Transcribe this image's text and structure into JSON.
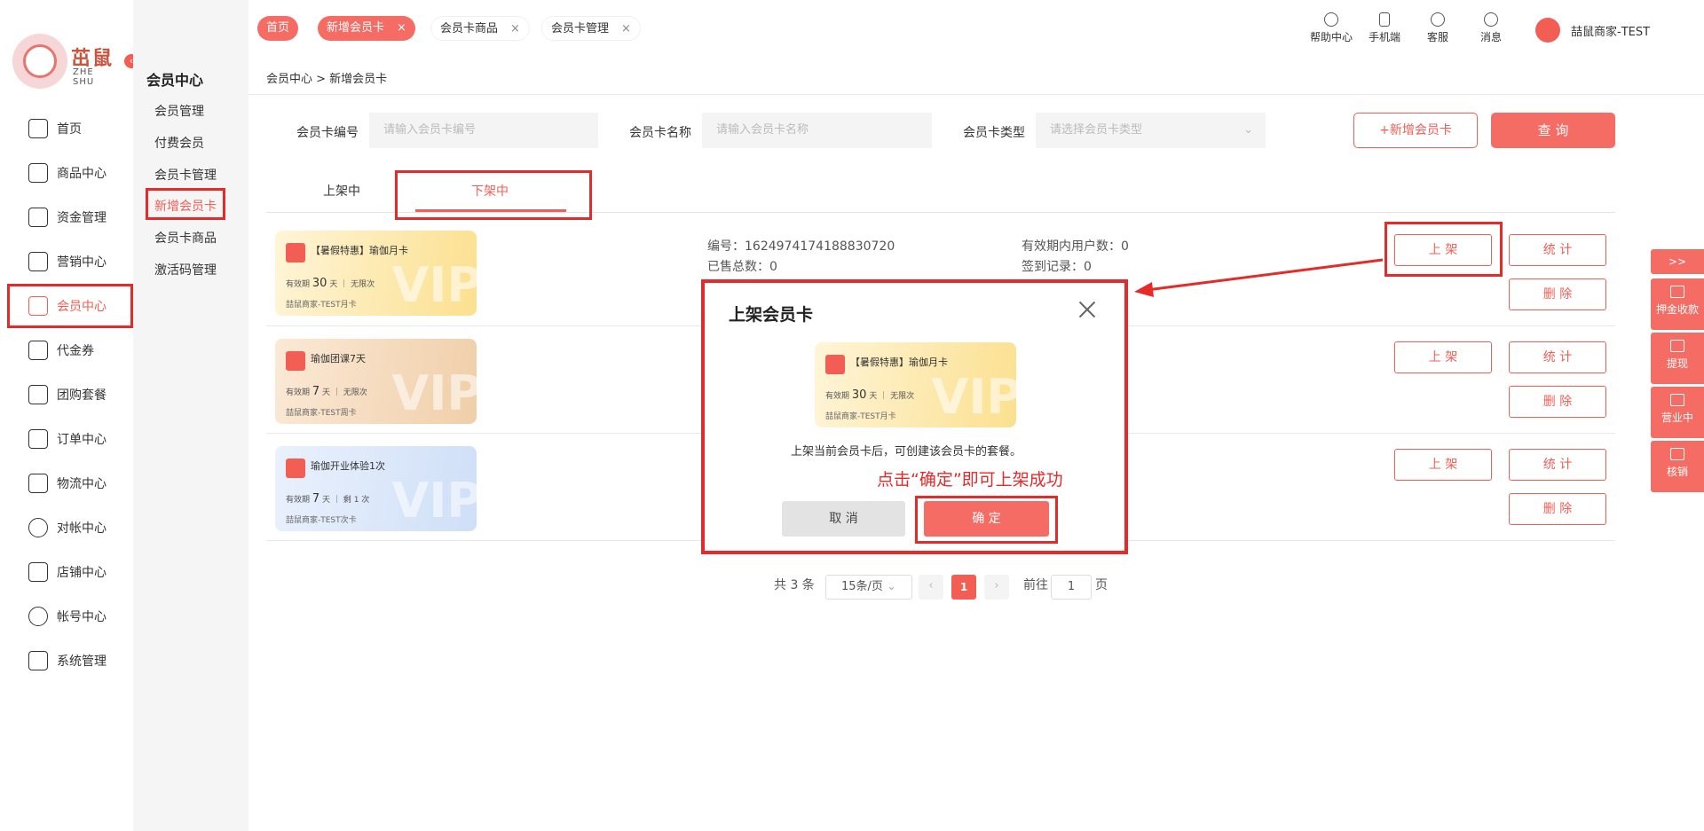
{
  "brand": {
    "logo_text": "茁鼠",
    "logo_sub": "ZHE SHU"
  },
  "sidebar": {
    "items": [
      {
        "label": "首页",
        "icon": "home-icon"
      },
      {
        "label": "商品中心",
        "icon": "cart-icon"
      },
      {
        "label": "资金管理",
        "icon": "layers-icon"
      },
      {
        "label": "营销中心",
        "icon": "video-icon"
      },
      {
        "label": "会员中心",
        "icon": "vip-card-icon",
        "active": true
      },
      {
        "label": "代金券",
        "icon": "coupon-icon"
      },
      {
        "label": "团购套餐",
        "icon": "bag-icon"
      },
      {
        "label": "订单中心",
        "icon": "list-icon"
      },
      {
        "label": "物流中心",
        "icon": "box-icon"
      },
      {
        "label": "对帐中心",
        "icon": "yen-icon"
      },
      {
        "label": "店铺中心",
        "icon": "store-icon"
      },
      {
        "label": "帐号中心",
        "icon": "user-icon"
      },
      {
        "label": "系统管理",
        "icon": "settings-icon"
      }
    ]
  },
  "subnav": {
    "title": "会员中心",
    "items": [
      {
        "label": "会员管理"
      },
      {
        "label": "付费会员"
      },
      {
        "label": "会员卡管理"
      },
      {
        "label": "新增会员卡",
        "active": true
      },
      {
        "label": "会员卡商品"
      },
      {
        "label": "激活码管理"
      }
    ]
  },
  "topbar": {
    "tabs": [
      {
        "label": "首页",
        "style": "home"
      },
      {
        "label": "新增会员卡",
        "style": "active",
        "close": "×"
      },
      {
        "label": "会员卡商品",
        "style": "normal",
        "close": "×"
      },
      {
        "label": "会员卡管理",
        "style": "normal",
        "close": "×"
      }
    ],
    "tools": [
      {
        "label": "帮助中心",
        "icon": "help-icon"
      },
      {
        "label": "手机端",
        "icon": "mobile-icon"
      },
      {
        "label": "客服",
        "icon": "headset-icon"
      },
      {
        "label": "消息",
        "icon": "message-icon"
      }
    ],
    "user_name": "喆鼠商家-TEST"
  },
  "breadcrumb": "会员中心 > 新增会员卡",
  "filters": {
    "code_label": "会员卡编号",
    "code_placeholder": "请输入会员卡编号",
    "name_label": "会员卡名称",
    "name_placeholder": "请输入会员卡名称",
    "type_label": "会员卡类型",
    "type_placeholder": "请选择会员卡类型",
    "add_button": "+新增会员卡",
    "query_button": "查 询"
  },
  "status_tabs": {
    "on": "上架中",
    "off": "下架中"
  },
  "cards": [
    {
      "title": "【暑假特惠】瑜伽月卡",
      "valid_prefix": "有效期",
      "valid_num": "30",
      "valid_unit": "天",
      "limit": "无限次",
      "footer": "喆鼠商家-TEST月卡",
      "code": "编号：1624974174188830720",
      "sold": "已售总数：0",
      "users": "有效期内用户数：0",
      "checkins": "签到记录：0"
    },
    {
      "title": "瑜伽团课7天",
      "valid_prefix": "有效期",
      "valid_num": "7",
      "valid_unit": "天",
      "limit": "无限次",
      "footer": "喆鼠商家-TEST周卡"
    },
    {
      "title": "瑜伽开业体验1次",
      "valid_prefix": "有效期",
      "valid_num": "7",
      "valid_unit": "天",
      "limit": "1 次",
      "limit_prefix": "剩",
      "footer": "喆鼠商家-TEST次卡"
    }
  ],
  "row_actions": {
    "list": "上 架",
    "stats": "统 计",
    "delete": "删 除"
  },
  "pagination": {
    "total": "共 3 条",
    "page_size": "15条/页",
    "current": "1",
    "goto_label": "前往",
    "goto_value": "1",
    "page_unit": "页"
  },
  "dialog": {
    "title": "上架会员卡",
    "message": "上架当前会员卡后，可创建该会员卡的套餐。",
    "hint": "点击“确定”即可上架成功",
    "cancel": "取 消",
    "confirm": "确 定"
  },
  "right_float": {
    "expand": ">>",
    "items": [
      {
        "label": "押金收款",
        "icon": "deposit-icon"
      },
      {
        "label": "提现",
        "icon": "withdraw-icon"
      },
      {
        "label": "营业中",
        "icon": "shop-open-icon"
      },
      {
        "label": "核销",
        "icon": "verify-icon"
      }
    ]
  },
  "colors": {
    "accent": "#f25e54",
    "annotation": "#e52a2a"
  },
  "vip_watermark": "VIP"
}
